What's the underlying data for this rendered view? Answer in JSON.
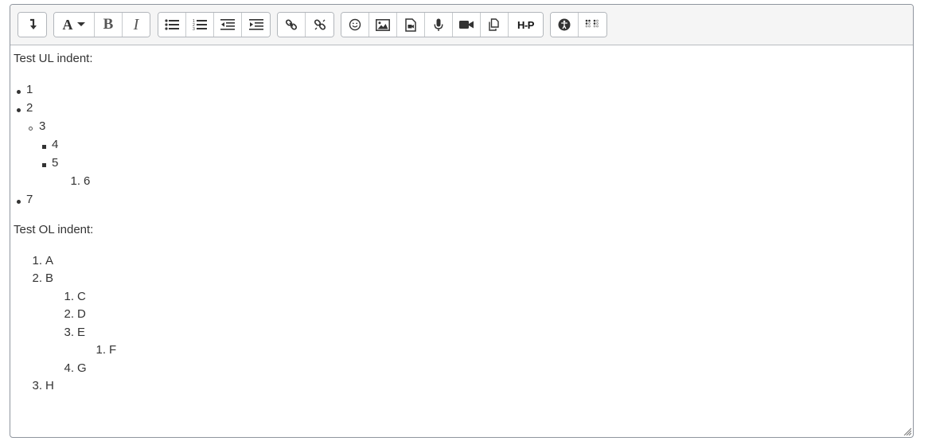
{
  "toolbar": {
    "groups": [
      {
        "buttons": [
          {
            "icon": "collapse-toggle-icon"
          }
        ]
      },
      {
        "buttons": [
          {
            "icon": "font-style-icon"
          },
          {
            "icon": "bold-icon"
          },
          {
            "icon": "italic-icon"
          }
        ]
      },
      {
        "buttons": [
          {
            "icon": "unordered-list-icon"
          },
          {
            "icon": "ordered-list-icon"
          },
          {
            "icon": "outdent-icon"
          },
          {
            "icon": "indent-icon"
          }
        ]
      },
      {
        "buttons": [
          {
            "icon": "link-icon"
          },
          {
            "icon": "unlink-icon"
          }
        ]
      },
      {
        "buttons": [
          {
            "icon": "emoji-icon"
          },
          {
            "icon": "image-icon"
          },
          {
            "icon": "media-icon"
          },
          {
            "icon": "microphone-icon"
          },
          {
            "icon": "video-camera-icon"
          },
          {
            "icon": "manage-files-icon"
          },
          {
            "icon": "h5p-icon"
          }
        ]
      },
      {
        "buttons": [
          {
            "icon": "accessibility-checker-icon"
          },
          {
            "icon": "screen-reader-helper-icon"
          }
        ]
      }
    ],
    "h5p_label": "H-P",
    "font_label": "A",
    "bold_label": "B",
    "italic_label": "I"
  },
  "content": {
    "ul_heading": "Test UL indent:",
    "ul_items": [
      "1",
      "2",
      "3",
      "4",
      "5",
      "6",
      "7"
    ],
    "ol_heading": "Test OL indent:",
    "ol_items": [
      "A",
      "B",
      "C",
      "D",
      "E",
      "F",
      "G",
      "H"
    ],
    "markers": {
      "ul_nested_ol": "1.",
      "ol_top": [
        "1.",
        "2.",
        "3."
      ],
      "ol_level2": [
        "1.",
        "2.",
        "3.",
        "4."
      ],
      "ol_level3": [
        "1."
      ]
    }
  }
}
